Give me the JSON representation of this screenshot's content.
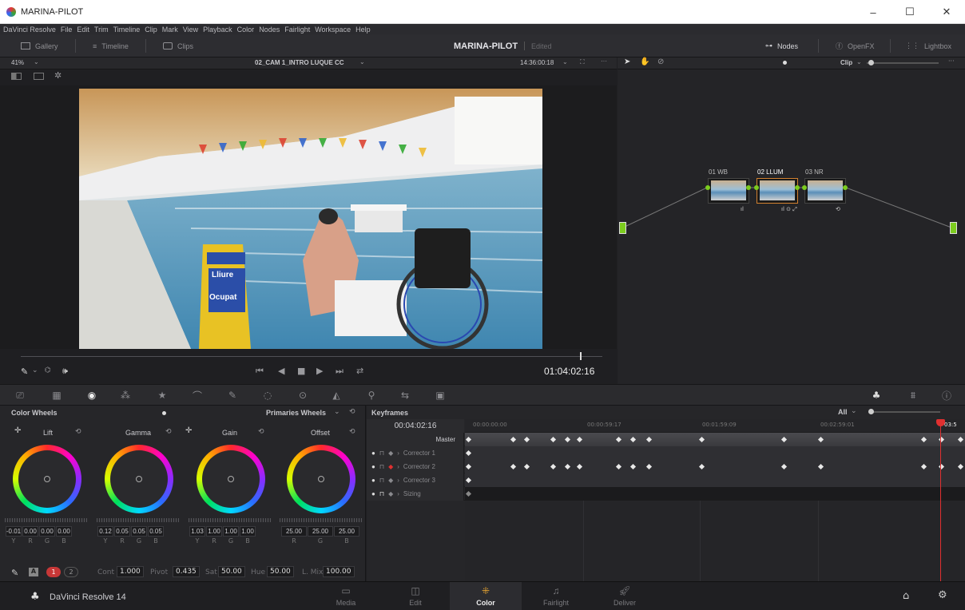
{
  "window": {
    "title": "MARINA-PILOT",
    "minimize": "–",
    "maximize": "☐",
    "close": "✕"
  },
  "menu": [
    "DaVinci Resolve",
    "File",
    "Edit",
    "Trim",
    "Timeline",
    "Clip",
    "Mark",
    "View",
    "Playback",
    "Color",
    "Nodes",
    "Fairlight",
    "Workspace",
    "Help"
  ],
  "toolbar": {
    "gallery": "Gallery",
    "timeline": "Timeline",
    "clips": "Clips",
    "project": "MARINA-PILOT",
    "status": "Edited",
    "nodes": "Nodes",
    "openfx": "OpenFX",
    "lightbox": "Lightbox"
  },
  "viewer": {
    "zoom": "41%",
    "clip_name": "02_CAM 1_INTRO LUQUE CC",
    "timecode_in": "14:36:00:18",
    "timecode": "01:04:02:16",
    "sign_top": "Lliure",
    "sign_bottom": "Ocupat"
  },
  "nodes": {
    "mode": "Clip",
    "items": [
      {
        "label": "01 WB",
        "icons": "ıl"
      },
      {
        "label": "02 LLUM",
        "icons": "ıl ⊙ ⤢"
      },
      {
        "label": "03 NR",
        "icons": "⟲"
      }
    ]
  },
  "colorwheels": {
    "title": "Color Wheels",
    "mode": "Primaries Wheels",
    "wheels": [
      {
        "name": "Lift",
        "values": [
          "-0.01",
          "0.00",
          "0.00",
          "0.00"
        ],
        "channels": [
          "Y",
          "R",
          "G",
          "B"
        ]
      },
      {
        "name": "Gamma",
        "values": [
          "0.12",
          "0.05",
          "0.05",
          "0.05"
        ],
        "channels": [
          "Y",
          "R",
          "G",
          "B"
        ]
      },
      {
        "name": "Gain",
        "values": [
          "1.03",
          "1.00",
          "1.00",
          "1.00"
        ],
        "channels": [
          "Y",
          "R",
          "G",
          "B"
        ]
      },
      {
        "name": "Offset",
        "values": [
          "25.00",
          "25.00",
          "25.00"
        ],
        "channels": [
          "R",
          "G",
          "B"
        ]
      }
    ],
    "page1": "1",
    "page2": "2",
    "cont_label": "Cont",
    "cont": "1.000",
    "pivot_label": "Pivot",
    "pivot": "0.435",
    "sat_label": "Sat",
    "sat": "50.00",
    "hue_label": "Hue",
    "hue": "50.00",
    "lmix_label": "L. Mix",
    "lmix": "100.00"
  },
  "keyframes": {
    "title": "Keyframes",
    "filter": "All",
    "current": "00:04:02:16",
    "ruler": [
      "00:00:00:00",
      "00:00:59:17",
      "00:01:59:09",
      "00:02:59:01",
      "03:5"
    ],
    "rows": [
      "Master",
      "Corrector 1",
      "Corrector 2",
      "Corrector 3",
      "Sizing"
    ]
  },
  "bottom": {
    "app": "DaVinci Resolve 14",
    "tabs": [
      "Media",
      "Edit",
      "Color",
      "Fairlight",
      "Deliver"
    ],
    "active": "Color"
  },
  "colors": {
    "accent": "#e0e0e0",
    "playhead": "#e03030",
    "node_green": "#7ccc1e",
    "bg": "#262629"
  }
}
